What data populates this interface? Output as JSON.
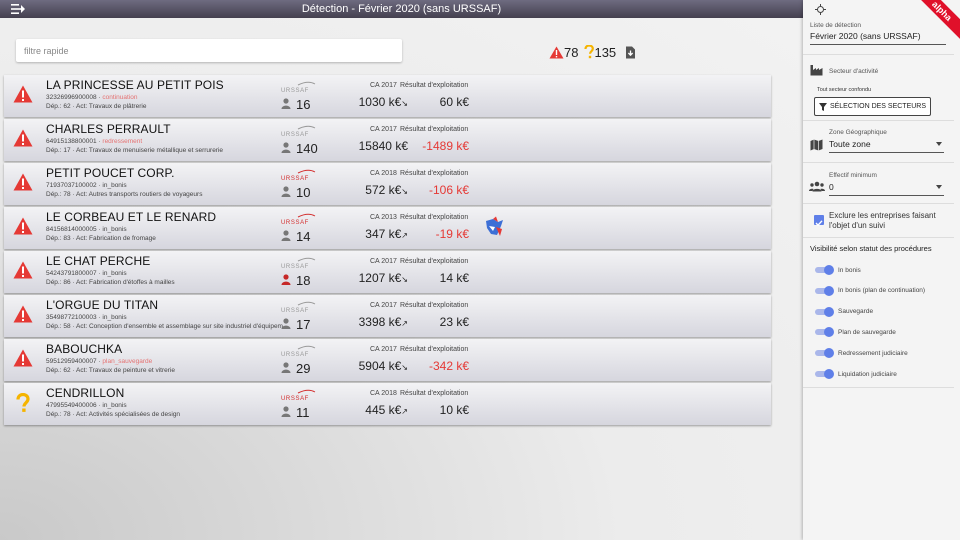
{
  "header": {
    "title": "Détection - Février 2020 (sans URSSAF)",
    "menu_icon": "menu-arrow-icon"
  },
  "search": {
    "placeholder": "filtre rapide"
  },
  "counters": {
    "alerts": "78",
    "questions": "135"
  },
  "companies": [
    {
      "level": "alert",
      "name": "LA PRINCESSE AU PETIT POIS",
      "siret": "32326996900008",
      "status": "continuation",
      "status_colored": true,
      "dep": "Dép.: 62 · Act: Travaux de plâtrerie",
      "urssaf_active": false,
      "effectif": "16",
      "effectif_alert": false,
      "ca_year": "CA 2017",
      "ca": "1030 k€",
      "trend": "↘",
      "res_label": "Résultat d'exploitation",
      "res": "60 k€",
      "res_neg": false,
      "badge": false
    },
    {
      "level": "alert",
      "name": "CHARLES PERRAULT",
      "siret": "64915138800001",
      "status": "redressement",
      "status_colored": true,
      "dep": "Dép.: 17 · Act: Travaux de menuiserie métallique et serrurerie",
      "urssaf_active": false,
      "effectif": "140",
      "effectif_alert": false,
      "ca_year": "CA 2017",
      "ca": "15840 k€",
      "trend": "",
      "res_label": "Résultat d'exploitation",
      "res": "-1489 k€",
      "res_neg": true,
      "badge": false
    },
    {
      "level": "alert",
      "name": "PETIT POUCET CORP.",
      "siret": "71937037100002",
      "status": "in_bonis",
      "status_colored": false,
      "dep": "Dép.: 78 · Act: Autres transports routiers de voyageurs",
      "urssaf_active": true,
      "effectif": "10",
      "effectif_alert": false,
      "ca_year": "CA 2018",
      "ca": "572 k€",
      "trend": "↘",
      "res_label": "Résultat d'exploitation",
      "res": "-106 k€",
      "res_neg": true,
      "badge": false
    },
    {
      "level": "alert",
      "name": "LE CORBEAU ET LE RENARD",
      "siret": "84156814000005",
      "status": "in_bonis",
      "status_colored": false,
      "dep": "Dép.: 83 · Act: Fabrication de fromage",
      "urssaf_active": true,
      "effectif": "14",
      "effectif_alert": false,
      "ca_year": "CA 2013",
      "ca": "347 k€",
      "trend": "↗",
      "res_label": "Résultat d'exploitation",
      "res": "-19 k€",
      "res_neg": true,
      "badge": true
    },
    {
      "level": "alert",
      "name": "LE CHAT PERCHE",
      "siret": "54243791800007",
      "status": "in_bonis",
      "status_colored": false,
      "dep": "Dép.: 86 · Act: Fabrication d'étoffes à mailles",
      "urssaf_active": false,
      "effectif": "18",
      "effectif_alert": true,
      "ca_year": "CA 2017",
      "ca": "1207 k€",
      "trend": "↘",
      "res_label": "Résultat d'exploitation",
      "res": "14 k€",
      "res_neg": false,
      "badge": false
    },
    {
      "level": "alert",
      "name": "L'ORGUE DU TITAN",
      "siret": "35498772100003",
      "status": "in_bonis",
      "status_colored": false,
      "dep": "Dép.: 58 · Act: Conception d'ensemble et assemblage sur site industriel d'équipem",
      "urssaf_active": false,
      "effectif": "17",
      "effectif_alert": false,
      "ca_year": "CA 2017",
      "ca": "3398 k€",
      "trend": "↗",
      "res_label": "Résultat d'exploitation",
      "res": "23 k€",
      "res_neg": false,
      "badge": false
    },
    {
      "level": "alert",
      "name": "BABOUCHKA",
      "siret": "59512959400007",
      "status": "plan_sauvegarde",
      "status_colored": true,
      "dep": "Dép.: 62 · Act: Travaux de peinture et vitrerie",
      "urssaf_active": false,
      "effectif": "29",
      "effectif_alert": false,
      "ca_year": "CA 2017",
      "ca": "5904 k€",
      "trend": "↘",
      "res_label": "Résultat d'exploitation",
      "res": "-342 k€",
      "res_neg": true,
      "badge": false
    },
    {
      "level": "question",
      "name": "CENDRILLON",
      "siret": "47995549400006",
      "status": "in_bonis",
      "status_colored": false,
      "dep": "Dép.: 78 · Act: Activités spécialisées de design",
      "urssaf_active": true,
      "effectif": "11",
      "effectif_alert": false,
      "ca_year": "CA 2018",
      "ca": "445 k€",
      "trend": "↗",
      "res_label": "Résultat d'exploitation",
      "res": "10 k€",
      "res_neg": false,
      "badge": false
    }
  ],
  "sidebar": {
    "ribbon": "alpha",
    "list_label": "Liste de détection",
    "list_value": "Février 2020 (sans URSSAF)",
    "sector_label": "Secteur d'activité",
    "sector_all": "Tout secteur confondu",
    "sector_button": "SÉLECTION DES SECTEURS",
    "zone_label": "Zone Géographique",
    "zone_value": "Toute zone",
    "eff_label": "Effectif minimum",
    "eff_value": "0",
    "exclude_label": "Exclure les entreprises faisant l'objet d'un suivi",
    "visibility_title": "Visibilité selon statut des procédures",
    "procedures": [
      "In bonis",
      "In bonis (plan de continuation)",
      "Sauvegarde",
      "Plan de sauvegarde",
      "Redressement judiciaire",
      "Liquidation judiciaire"
    ]
  },
  "colors": {
    "alert_red": "#e53935",
    "question_yellow": "#f5b400",
    "toggle_blue": "#5f7fe8",
    "negative": "#e53935"
  }
}
